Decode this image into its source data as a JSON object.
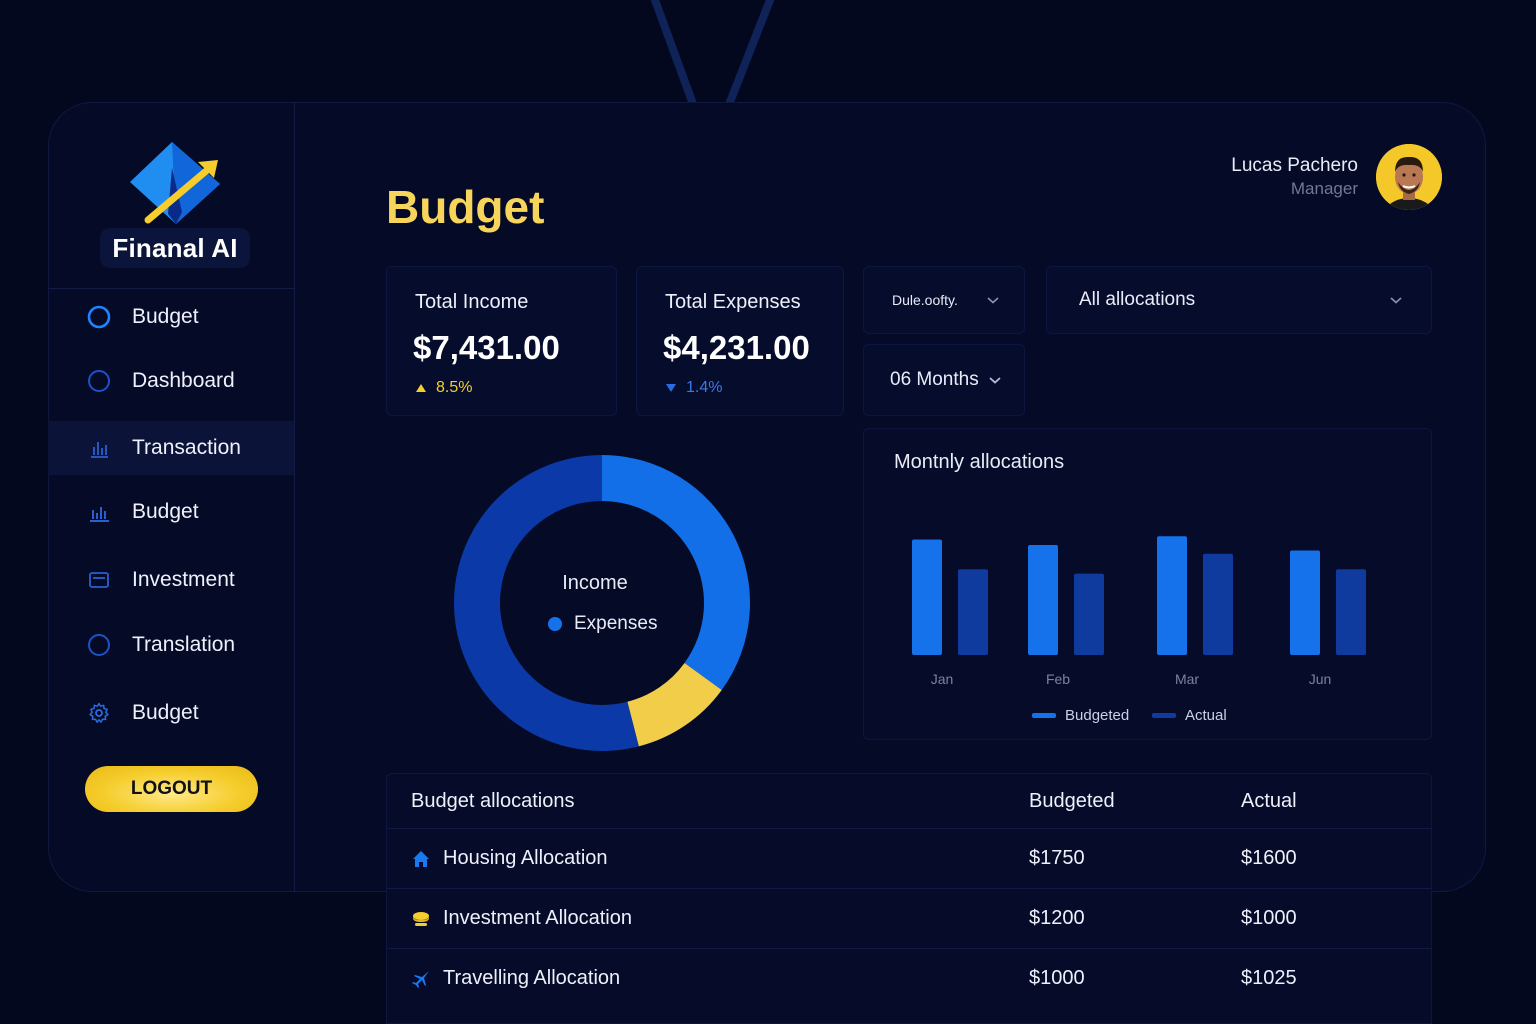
{
  "app": {
    "brand": "Finanal AI"
  },
  "sidebar": {
    "items": [
      {
        "label": "Budget",
        "icon": "circle-icon"
      },
      {
        "label": "Dashboard",
        "icon": "circle-icon"
      },
      {
        "label": "Transaction",
        "icon": "bar-chart-icon",
        "active": true
      },
      {
        "label": "Budget",
        "icon": "bar-chart-icon"
      },
      {
        "label": "Investment",
        "icon": "card-icon"
      },
      {
        "label": "Translation",
        "icon": "circle-icon"
      },
      {
        "label": "Budget",
        "icon": "gear-icon"
      }
    ],
    "logout_label": "LOGOUT"
  },
  "header": {
    "title": "Budget"
  },
  "user": {
    "name": "Lucas Pachero",
    "role": "Manager"
  },
  "stats": {
    "income": {
      "label": "Total Income",
      "value": "$7,431.00",
      "delta": "8.5%",
      "direction": "up"
    },
    "expenses": {
      "label": "Total Expenses",
      "value": "$4,231.00",
      "delta": "1.4%",
      "direction": "down"
    }
  },
  "filters": {
    "period_select": "Dule.oofty.",
    "allocation_select": "All allocations",
    "range_select": "06 Months"
  },
  "donut": {
    "center_title": "Income",
    "center_legend": "Expenses",
    "segments": [
      {
        "name": "segment-1",
        "value": 35,
        "color": "#126fe8"
      },
      {
        "name": "segment-2",
        "value": 11,
        "color": "#f2cd4a"
      },
      {
        "name": "segment-3",
        "value": 54,
        "color": "#0b3aa8"
      }
    ]
  },
  "chart_data": {
    "type": "bar",
    "title": "Montnly allocations",
    "categories": [
      "Jan",
      "Feb",
      "Mar",
      "Jun"
    ],
    "series": [
      {
        "name": "Budgeted",
        "values": [
          105,
          100,
          108,
          95
        ],
        "color": "#1572ea"
      },
      {
        "name": "Actual",
        "values": [
          78,
          74,
          92,
          78
        ],
        "color": "#0f3a9e"
      }
    ],
    "ylim": [
      0,
      120
    ],
    "legend": "bottom"
  },
  "table": {
    "headers": [
      "Budget allocations",
      "Budgeted",
      "Actual"
    ],
    "rows": [
      {
        "name": "Housing Allocation",
        "budgeted": "$1750",
        "actual": "$1600",
        "icon": "house-icon"
      },
      {
        "name": "Investment Allocation",
        "budgeted": "$1200",
        "actual": "$1000",
        "icon": "coins-icon"
      },
      {
        "name": "Travelling Allocation",
        "budgeted": "$1000",
        "actual": "$1025",
        "icon": "plane-icon"
      }
    ]
  },
  "colors": {
    "accent": "#f7d55a",
    "primary": "#126fe8",
    "background": "#04081f"
  }
}
